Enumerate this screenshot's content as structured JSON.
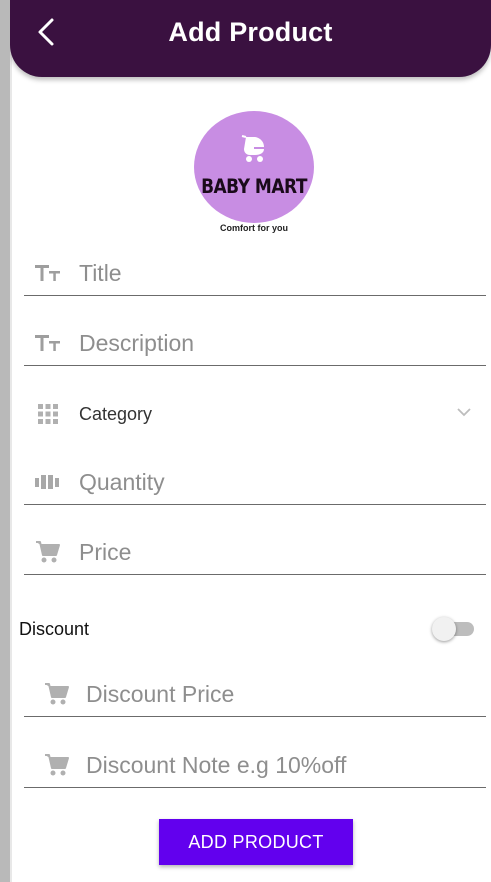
{
  "app_bar": {
    "title": "Add Product",
    "color": "#3a1140"
  },
  "logo": {
    "name": "BABY MART",
    "tagline": "Comfort for you",
    "color": "#c88de3",
    "icon": "stroller-icon"
  },
  "form": {
    "title": {
      "placeholder": "Title",
      "value": "",
      "icon": "text-size-icon"
    },
    "description": {
      "placeholder": "Description",
      "value": "",
      "icon": "text-size-icon"
    },
    "category": {
      "selected": "Category",
      "icon": "grid-icon"
    },
    "quantity": {
      "placeholder": "Quantity",
      "value": "",
      "icon": "inventory-icon"
    },
    "price": {
      "placeholder": "Price",
      "value": "",
      "icon": "cart-icon"
    },
    "discount": {
      "label": "Discount",
      "enabled": false
    },
    "discount_price": {
      "placeholder": "Discount Price",
      "value": "",
      "icon": "cart-icon"
    },
    "discount_note": {
      "placeholder": "Discount Note e.g 10%off",
      "value": "",
      "icon": "cart-icon"
    }
  },
  "submit": {
    "label": "ADD PRODUCT",
    "color": "#6200ee"
  }
}
